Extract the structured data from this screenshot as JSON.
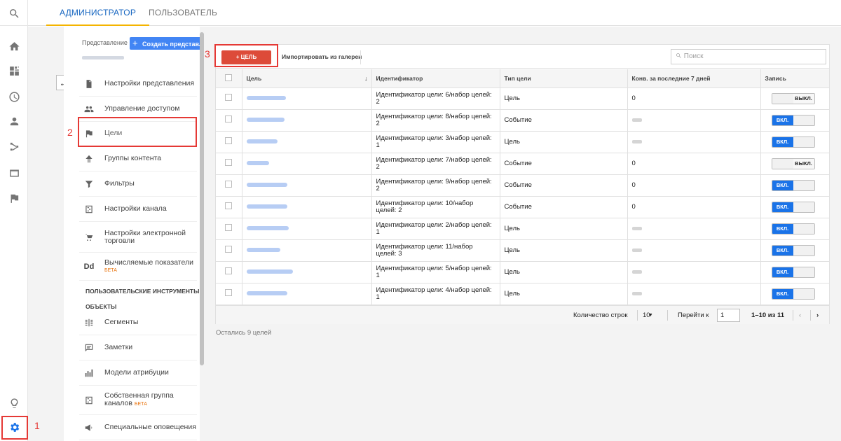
{
  "tabs": {
    "admin": "АДМИНИСТРАТОР",
    "user": "ПОЛЬЗОВАТЕЛЬ"
  },
  "rail": {
    "icons": [
      "search-icon",
      "home-icon",
      "dashboard-icon",
      "clock-icon",
      "person-icon",
      "acquisition-icon",
      "behavior-icon",
      "flag-icon",
      "lightbulb-icon",
      "gear-icon"
    ]
  },
  "view_panel": {
    "label": "Представление",
    "create_button": "Создать представл"
  },
  "nav": {
    "items": [
      {
        "label": "Настройки представления",
        "icon": "document-icon"
      },
      {
        "label": "Управление доступом",
        "icon": "people-icon"
      },
      {
        "label": "Цели",
        "icon": "flag-icon"
      },
      {
        "label": "Группы контента",
        "icon": "person-walk-icon"
      },
      {
        "label": "Фильтры",
        "icon": "funnel-icon"
      },
      {
        "label": "Настройки канала",
        "icon": "channel-icon"
      },
      {
        "label": "Настройки электронной торговли",
        "icon": "cart-icon"
      },
      {
        "label": "Вычисляемые показатели",
        "icon": "dd-icon",
        "beta": "БЕТА"
      }
    ],
    "section_title": "ПОЛЬЗОВАТЕЛЬСКИЕ ИНСТРУМЕНТЫ И ОБЪЕКТЫ",
    "section_title_line1": "ПОЛЬЗОВАТЕЛЬСКИЕ ИНСТРУМЕНТЫ И",
    "section_title_line2": "ОБЪЕКТЫ",
    "tools": [
      {
        "label": "Сегменты",
        "icon": "segments-icon"
      },
      {
        "label": "Заметки",
        "icon": "notes-icon"
      },
      {
        "label": "Модели атрибуции",
        "icon": "bar-chart-icon"
      },
      {
        "label": "Собственная группа каналов",
        "icon": "channel-group-icon",
        "beta": "БЕТА"
      },
      {
        "label": "Специальные оповещения",
        "icon": "megaphone-icon"
      }
    ]
  },
  "annotations": {
    "n1": "1",
    "n2": "2",
    "n3": "3"
  },
  "toolbar": {
    "new_goal": "+ ЦЕЛЬ",
    "import": "Импортировать из галереи",
    "search_placeholder": "Поиск"
  },
  "table": {
    "headers": [
      "Цель",
      "Идентификатор",
      "Тип цели",
      "Конв. за последние 7 дней",
      "Запись"
    ],
    "rows": [
      {
        "id_text": "Идентификатор цели: 6/набор целей: 2",
        "type": "Цель",
        "conv": "0",
        "conv_visible": true,
        "record": "ВЫКЛ.",
        "on": false,
        "name_w": 56
      },
      {
        "id_text": "Идентификатор цели: 8/набор целей: 2",
        "type": "Событие",
        "conv": "",
        "conv_visible": false,
        "record": "ВКЛ.",
        "on": true,
        "name_w": 54
      },
      {
        "id_text": "Идентификатор цели: 3/набор целей: 1",
        "type": "Цель",
        "conv": "",
        "conv_visible": false,
        "record": "ВКЛ.",
        "on": true,
        "name_w": 44
      },
      {
        "id_text": "Идентификатор цели: 7/набор целей: 2",
        "type": "Событие",
        "conv": "0",
        "conv_visible": true,
        "record": "ВЫКЛ.",
        "on": false,
        "name_w": 32
      },
      {
        "id_text": "Идентификатор цели: 9/набор целей: 2",
        "type": "Событие",
        "conv": "0",
        "conv_visible": true,
        "record": "ВКЛ.",
        "on": true,
        "name_w": 58
      },
      {
        "id_text": "Идентификатор цели: 10/набор целей: 2",
        "type": "Событие",
        "conv": "0",
        "conv_visible": true,
        "record": "ВКЛ.",
        "on": true,
        "name_w": 58
      },
      {
        "id_text": "Идентификатор цели: 2/набор целей: 1",
        "type": "Цель",
        "conv": "",
        "conv_visible": false,
        "record": "ВКЛ.",
        "on": true,
        "name_w": 60
      },
      {
        "id_text": "Идентификатор цели: 11/набор целей: 3",
        "type": "Цель",
        "conv": "",
        "conv_visible": false,
        "record": "ВКЛ.",
        "on": true,
        "name_w": 48
      },
      {
        "id_text": "Идентификатор цели: 5/набор целей: 1",
        "type": "Цель",
        "conv": "",
        "conv_visible": false,
        "record": "ВКЛ.",
        "on": true,
        "name_w": 66
      },
      {
        "id_text": "Идентификатор цели: 4/набор целей: 1",
        "type": "Цель",
        "conv": "",
        "conv_visible": false,
        "record": "ВКЛ.",
        "on": true,
        "name_w": 58
      }
    ]
  },
  "pager": {
    "rows_label": "Количество строк",
    "rows_value": "10",
    "goto_label": "Перейти к",
    "goto_value": "1",
    "range": "1–10 из 11"
  },
  "footer": {
    "remaining": "Остались 9 целей"
  }
}
